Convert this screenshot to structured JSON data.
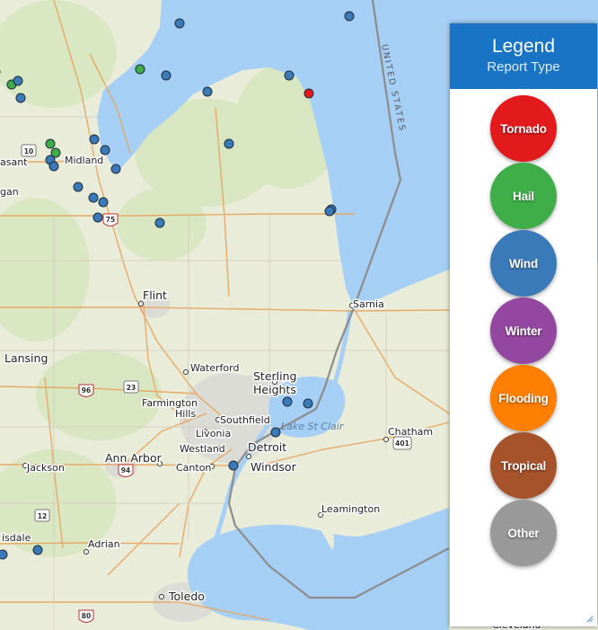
{
  "legend": {
    "title": "Legend",
    "subtitle": "Report Type",
    "items": [
      {
        "label": "Tornado",
        "color": "#e31a1c"
      },
      {
        "label": "Hail",
        "color": "#3fae49"
      },
      {
        "label": "Wind",
        "color": "#3a7ab8"
      },
      {
        "label": "Winter",
        "color": "#9447a1"
      },
      {
        "label": "Flooding",
        "color": "#ff7f00"
      },
      {
        "label": "Tropical",
        "color": "#a6522b"
      },
      {
        "label": "Other",
        "color": "#999999"
      }
    ]
  },
  "map": {
    "water_color": "#a6cff5",
    "land_color": "#e9ecd8",
    "border_label": "UNITED STATES",
    "lake_label": "Lake St Clair",
    "cities": [
      "Midland",
      "Flint",
      "Sarnia",
      "Lansing",
      "Waterford",
      "Sterling Heights",
      "Farmington Hills",
      "Southfield",
      "Livonia",
      "Westland",
      "Canton",
      "Detroit",
      "Windsor",
      "Ann Arbor",
      "Jackson",
      "Chatham",
      "Leamington",
      "Adrian",
      "Toledo",
      "Cleveland",
      "isdale",
      "asant",
      "gan"
    ],
    "highway_shields": [
      "10",
      "75",
      "96",
      "23",
      "94",
      "12",
      "401",
      "80"
    ],
    "storm_reports": [
      {
        "type": "Wind"
      },
      {
        "type": "Wind"
      },
      {
        "type": "Hail"
      },
      {
        "type": "Hail"
      },
      {
        "type": "Wind"
      },
      {
        "type": "Wind"
      },
      {
        "type": "Wind"
      },
      {
        "type": "Tornado"
      },
      {
        "type": "Wind"
      },
      {
        "type": "Wind"
      },
      {
        "type": "Wind"
      },
      {
        "type": "Wind"
      },
      {
        "type": "Hail"
      },
      {
        "type": "Hail"
      },
      {
        "type": "Wind"
      },
      {
        "type": "Wind"
      },
      {
        "type": "Wind"
      },
      {
        "type": "Wind"
      },
      {
        "type": "Wind"
      },
      {
        "type": "Wind"
      },
      {
        "type": "Wind"
      },
      {
        "type": "Wind"
      },
      {
        "type": "Wind"
      },
      {
        "type": "Wind"
      },
      {
        "type": "Wind"
      },
      {
        "type": "Wind"
      },
      {
        "type": "Wind"
      },
      {
        "type": "Wind"
      },
      {
        "type": "Wind"
      },
      {
        "type": "Wind"
      },
      {
        "type": "Wind"
      },
      {
        "type": "Wind"
      }
    ]
  }
}
